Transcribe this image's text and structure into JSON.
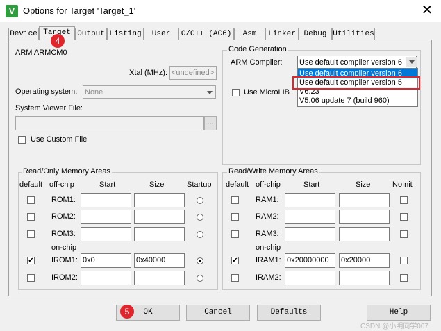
{
  "window": {
    "title": "Options for Target 'Target_1'",
    "close_glyph": "✕",
    "app_icon_glyph": "V"
  },
  "tabs": [
    "Device",
    "Target",
    "Output",
    "Listing",
    "User",
    "C/C++ (AC6)",
    "Asm",
    "Linker",
    "Debug",
    "Utilities"
  ],
  "device": {
    "name": "ARM ARMCM0",
    "xtal_label": "Xtal (MHz):",
    "xtal_value": "<undefined>",
    "os_label": "Operating system:",
    "os_value": "None",
    "svf_label": "System Viewer File:",
    "browse_label": "...",
    "custom_file_label": "Use Custom File"
  },
  "code_generation": {
    "title": "Code Generation",
    "compiler_label": "ARM Compiler:",
    "compiler_value": "Use default compiler version 6",
    "microlib_label": "Use MicroLIB",
    "dropdown_options": [
      "Use default compiler version 6",
      "Use default compiler version 5",
      "V6.23",
      "V5.06 update 7 (build 960)"
    ]
  },
  "ro_memory": {
    "title": "Read/Only Memory Areas",
    "headers": {
      "default": "default",
      "offchip": "off-chip",
      "start": "Start",
      "size": "Size",
      "last": "Startup"
    },
    "onchip_label": "on-chip",
    "rows": [
      {
        "name": "ROM1:",
        "start": "",
        "size": "",
        "checked": false,
        "selected": false
      },
      {
        "name": "ROM2:",
        "start": "",
        "size": "",
        "checked": false,
        "selected": false
      },
      {
        "name": "ROM3:",
        "start": "",
        "size": "",
        "checked": false,
        "selected": false
      },
      {
        "name": "IROM1:",
        "start": "0x0",
        "size": "0x40000",
        "checked": true,
        "selected": true
      },
      {
        "name": "IROM2:",
        "start": "",
        "size": "",
        "checked": false,
        "selected": false
      }
    ]
  },
  "rw_memory": {
    "title": "Read/Write Memory Areas",
    "headers": {
      "default": "default",
      "offchip": "off-chip",
      "start": "Start",
      "size": "Size",
      "last": "NoInit"
    },
    "onchip_label": "on-chip",
    "rows": [
      {
        "name": "RAM1:",
        "start": "",
        "size": "",
        "checked": false,
        "noinit": false
      },
      {
        "name": "RAM2:",
        "start": "",
        "size": "",
        "checked": false,
        "noinit": false
      },
      {
        "name": "RAM3:",
        "start": "",
        "size": "",
        "checked": false,
        "noinit": false
      },
      {
        "name": "IRAM1:",
        "start": "0x20000000",
        "size": "0x20000",
        "checked": true,
        "noinit": false
      },
      {
        "name": "IRAM2:",
        "start": "",
        "size": "",
        "checked": false,
        "noinit": false
      }
    ]
  },
  "buttons": {
    "ok": "OK",
    "cancel": "Cancel",
    "defaults": "Defaults",
    "help": "Help"
  },
  "annotations": {
    "badge_tab": "4",
    "badge_ok": "5",
    "highlight_color": "#e0262c"
  },
  "check_glyph": "✔",
  "watermark": "CSDN @小明同学007"
}
